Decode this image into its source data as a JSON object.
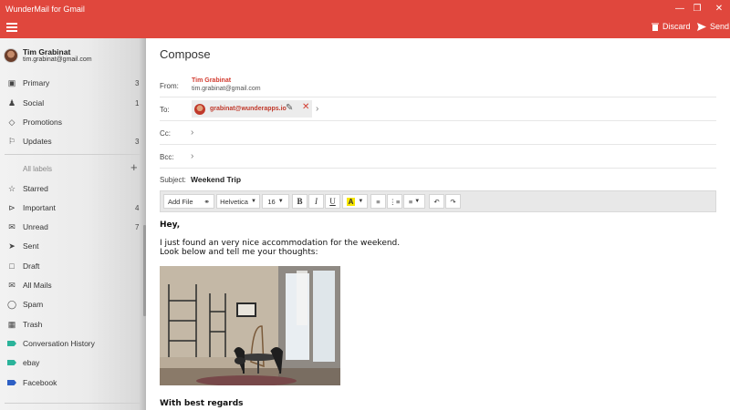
{
  "window": {
    "title": "WunderMail for Gmail"
  },
  "header": {
    "discard_label": "Discard",
    "send_label": "Send"
  },
  "account": {
    "name": "Tim Grabinat",
    "email": "tim.grabinat@gmail.com"
  },
  "sidebar": {
    "inbox_items": [
      {
        "label": "Primary",
        "icon": "inbox-icon",
        "count": "3"
      },
      {
        "label": "Social",
        "icon": "social-icon",
        "count": "1"
      },
      {
        "label": "Promotions",
        "icon": "tag-icon",
        "count": ""
      },
      {
        "label": "Updates",
        "icon": "updates-icon",
        "count": "3"
      }
    ],
    "labels_heading": "All labels",
    "label_items": [
      {
        "label": "Starred",
        "icon": "star-icon",
        "count": ""
      },
      {
        "label": "Important",
        "icon": "important-icon",
        "count": "4"
      },
      {
        "label": "Unread",
        "icon": "unread-icon",
        "count": "7"
      },
      {
        "label": "Sent",
        "icon": "sent-icon",
        "count": ""
      },
      {
        "label": "Draft",
        "icon": "draft-icon",
        "count": ""
      },
      {
        "label": "All Mails",
        "icon": "all-mail-icon",
        "count": ""
      },
      {
        "label": "Spam",
        "icon": "spam-icon",
        "count": ""
      },
      {
        "label": "Trash",
        "icon": "trash-icon",
        "count": ""
      }
    ],
    "custom_labels": [
      {
        "label": "Conversation History",
        "color": "#2bb39a"
      },
      {
        "label": "ebay",
        "color": "#2bb39a"
      },
      {
        "label": "Facebook",
        "color": "#2d5fc4"
      }
    ]
  },
  "compose": {
    "title": "Compose",
    "from_label": "From:",
    "from_name": "Tim Grabinat",
    "from_email": "tim.grabinat@gmail.com",
    "to_label": "To:",
    "to_recipient": "grabinat@wunderapps.io",
    "cc_label": "Cc:",
    "bcc_label": "Bcc:",
    "subject_label": "Subject:",
    "subject_value": "Weekend Trip"
  },
  "toolbar": {
    "add_file": "Add File",
    "font_family": "Helvetica",
    "font_size": "16",
    "bold": "B",
    "italic": "I",
    "underline": "U",
    "highlight": "A"
  },
  "body": {
    "greeting": "Hey,",
    "line1": "I just found an very nice accommodation for the weekend.",
    "line2": "Look below and tell me your thoughts:",
    "closing": "With best regards"
  },
  "colors": {
    "accent": "#e0473d",
    "highlight": "#f7e600"
  }
}
